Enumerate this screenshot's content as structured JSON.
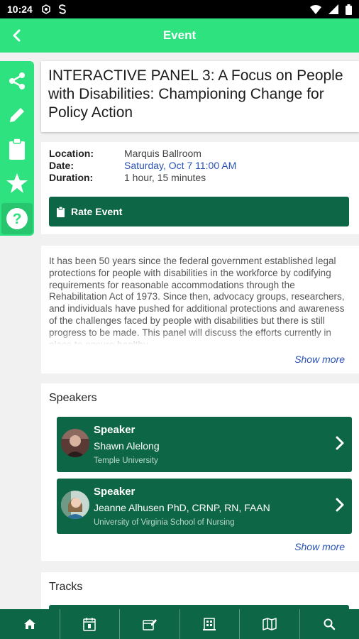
{
  "status_bar": {
    "time": "10:24"
  },
  "app_bar": {
    "title": "Event"
  },
  "event": {
    "title": "INTERACTIVE PANEL 3: A Focus on People with Disabilities: Championing Change for Policy Action",
    "location_label": "Location:",
    "location": "Marquis Ballroom",
    "date_label": "Date:",
    "date": "Saturday, Oct 7 11:00 AM",
    "duration_label": "Duration:",
    "duration": "1 hour, 15 minutes",
    "rate_label": "Rate Event",
    "description": "It has been 50 years since the federal government established legal protections for people with disabilities in the workforce by codifying requirements for reasonable accommodations through the Rehabilitation Act of 1973. Since then, advocacy groups, researchers, and individuals have pushed for additional protections and awareness of the challenges faced by people with disabilities but there is still progress to be made. This panel will discuss the efforts currently in place to ensure healthy",
    "description_show_more": "Show more"
  },
  "speakers": {
    "title": "Speakers",
    "items": [
      {
        "role": "Speaker",
        "name": "Shawn Alelong",
        "org": "Temple University"
      },
      {
        "role": "Speaker",
        "name": "Jeanne Alhusen PhD, CRNP, RN, FAAN",
        "org": "University of Virginia School of Nursing"
      }
    ],
    "show_more": "Show more"
  },
  "tracks": {
    "title": "Tracks"
  },
  "colors": {
    "accent": "#2de27f",
    "primary_dark": "#0d6645",
    "link": "#2952b3"
  }
}
